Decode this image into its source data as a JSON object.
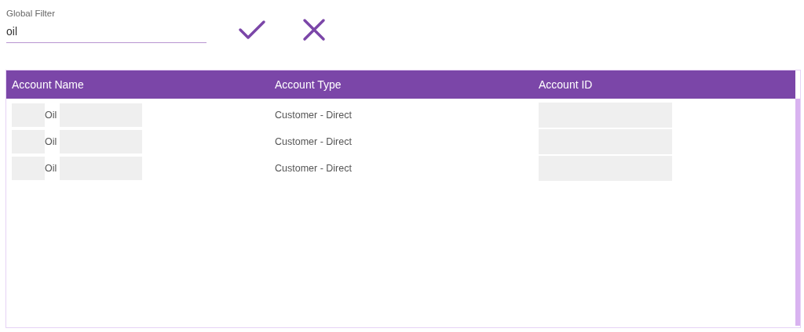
{
  "filter": {
    "label": "Global Filter",
    "value": "oil"
  },
  "table": {
    "columns": [
      "Account Name",
      "Account Type",
      "Account ID"
    ],
    "rows": [
      {
        "account_name": "Oil",
        "account_type": "Customer - Direct"
      },
      {
        "account_name": "Oil",
        "account_type": "Customer - Direct"
      },
      {
        "account_name": "Oil",
        "account_type": "Customer - Direct"
      }
    ]
  }
}
